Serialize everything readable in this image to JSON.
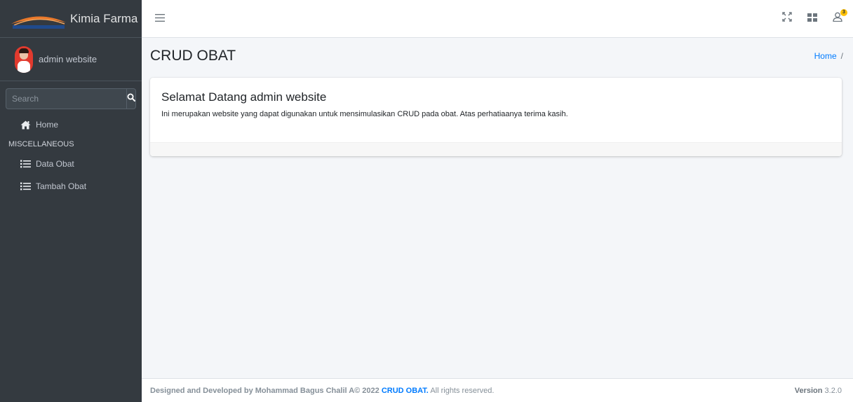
{
  "brand": {
    "name": "Kimia Farma",
    "logo_text": "Kimia Farma"
  },
  "user": {
    "name": "admin website"
  },
  "search": {
    "placeholder": "Search"
  },
  "nav": {
    "home_label": "Home",
    "section_header": "MISCELLANEOUS",
    "items": [
      {
        "label": "Data Obat",
        "icon": "list-icon"
      },
      {
        "label": "Tambah Obat",
        "icon": "list-icon"
      }
    ]
  },
  "topbar": {
    "notification_count": "3",
    "icons": [
      "menu-icon",
      "fullscreen-icon",
      "grid-icon",
      "user-icon"
    ]
  },
  "page": {
    "title": "CRUD OBAT",
    "breadcrumb_home": "Home",
    "breadcrumb_sep": "/"
  },
  "card": {
    "title": "Selamat Datang admin website",
    "text": "Ini merupakan website yang dapat digunakan untuk mensimulasikan CRUD pada obat. Atas perhatiaanya terima kasih."
  },
  "footer": {
    "prefix": "Designed and Developed by Mohammad Bagus Chalil A© 2022",
    "brand": "CRUD OBAT.",
    "suffix": "All rights reserved.",
    "version_label": "Version",
    "version_value": "3.2.0"
  },
  "colors": {
    "sidebar": "#343a40",
    "accent": "#007bff",
    "badge": "#ffc107",
    "background": "#f4f6f9"
  }
}
